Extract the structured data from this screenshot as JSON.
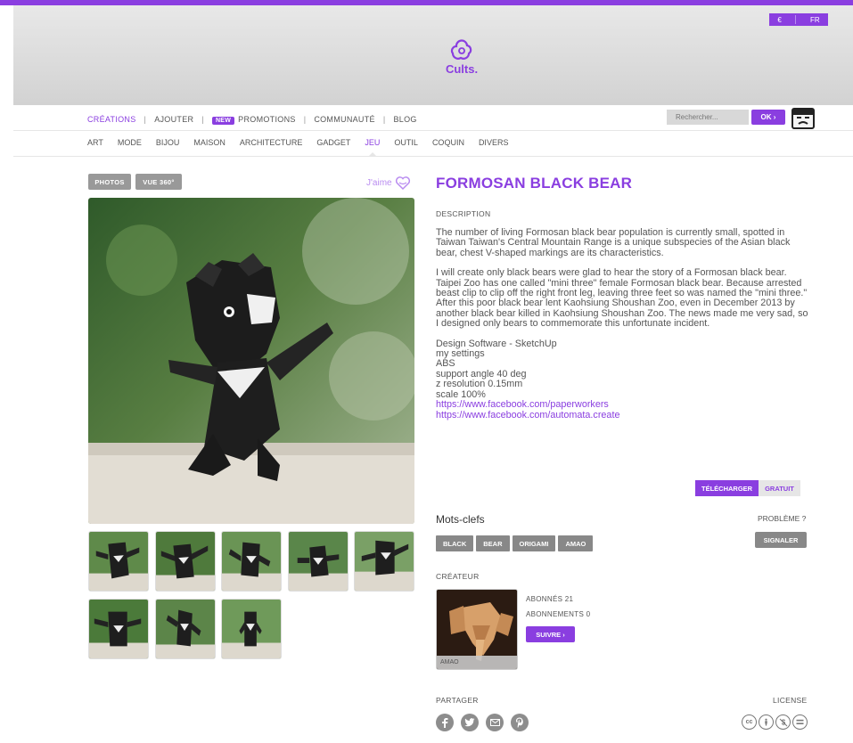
{
  "lang": {
    "currency": "€",
    "language": "FR"
  },
  "logo": {
    "text": "Cults."
  },
  "nav": {
    "creations": "CRÉATIONS",
    "ajouter": "AJOUTER",
    "new_badge": "NEW",
    "promotions": "PROMOTIONS",
    "communaute": "COMMUNAUTÉ",
    "blog": "BLOG",
    "separator": "|"
  },
  "search": {
    "placeholder": "Rechercher...",
    "ok_label": "OK ›"
  },
  "categories": [
    "ART",
    "MODE",
    "BIJOU",
    "MAISON",
    "ARCHITECTURE",
    "GADGET",
    "JEU",
    "OUTIL",
    "COQUIN",
    "DIVERS"
  ],
  "active_category": "JEU",
  "gallery": {
    "photos_label": "PHOTOS",
    "vue360_label": "VUE 360°",
    "like_label": "J'aime"
  },
  "product": {
    "title": "FORMOSAN BLACK BEAR",
    "description_label": "DESCRIPTION",
    "paragraph1": "The number of living Formosan black bear population is currently small, spotted in Taiwan Taiwan's Central Mountain Range is a unique subspecies of the Asian black bear, chest V-shaped markings are its characteristics.",
    "paragraph2": "I will create only black bears were glad to hear the story of a Formosan black bear.",
    "paragraph3": "Taipei Zoo has one called \"mini three\" female Formosan black bear. Because arrested beast clip to clip off the right front leg, leaving three feet so was named the \"mini three.\" After this poor black bear lent Kaohsiung Shoushan Zoo, even in December 2013 by another black bear killed in Kaohsiung Shoushan Zoo. The news made me very sad, so I designed only bears to commemorate this unfortunate incident.",
    "specs": [
      "Design Software - SketchUp",
      "my settings",
      "ABS",
      "support angle 40 deg",
      "z resolution 0.15mm",
      "scale 100%"
    ],
    "links": [
      "https://www.facebook.com/paperworkers",
      "https://www.facebook.com/automata.create"
    ],
    "download_label": "TÉLÉCHARGER",
    "price_label": "GRATUIT"
  },
  "keywords": {
    "title": "Mots-clefs",
    "tags": [
      "BLACK",
      "BEAR",
      "ORIGAMI",
      "AMAO"
    ],
    "probleme_label": "PROBLÈME ?",
    "signaler_label": "SIGNALER"
  },
  "creator": {
    "label": "CRÉATEUR",
    "name": "AMAO",
    "abonnes": "ABONNÉS 21",
    "abonnements": "ABONNEMENTS 0",
    "suivre_label": "SUIVRE ›"
  },
  "share": {
    "label": "PARTAGER",
    "license_label": "LICENSE",
    "icons": [
      "facebook-icon",
      "twitter-icon",
      "email-icon",
      "pinterest-icon"
    ]
  },
  "colors": {
    "accent": "#8a3ee0",
    "gray_button": "#999999"
  }
}
